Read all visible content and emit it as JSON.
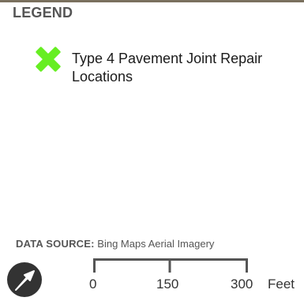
{
  "legend": {
    "title": "LEGEND",
    "items": [
      {
        "icon": "green-x-icon",
        "color": "#66ee22",
        "label": "Type 4 Pavement Joint Repair Locations"
      }
    ]
  },
  "data_source": {
    "label": "DATA SOURCE:",
    "value": "Bing Maps Aerial Imagery"
  },
  "scale_bar": {
    "ticks": [
      "0",
      "150",
      "300"
    ],
    "unit": "Feet",
    "color": "#555555"
  },
  "north_arrow": {
    "icon": "north-arrow-icon",
    "color": "#333333"
  }
}
